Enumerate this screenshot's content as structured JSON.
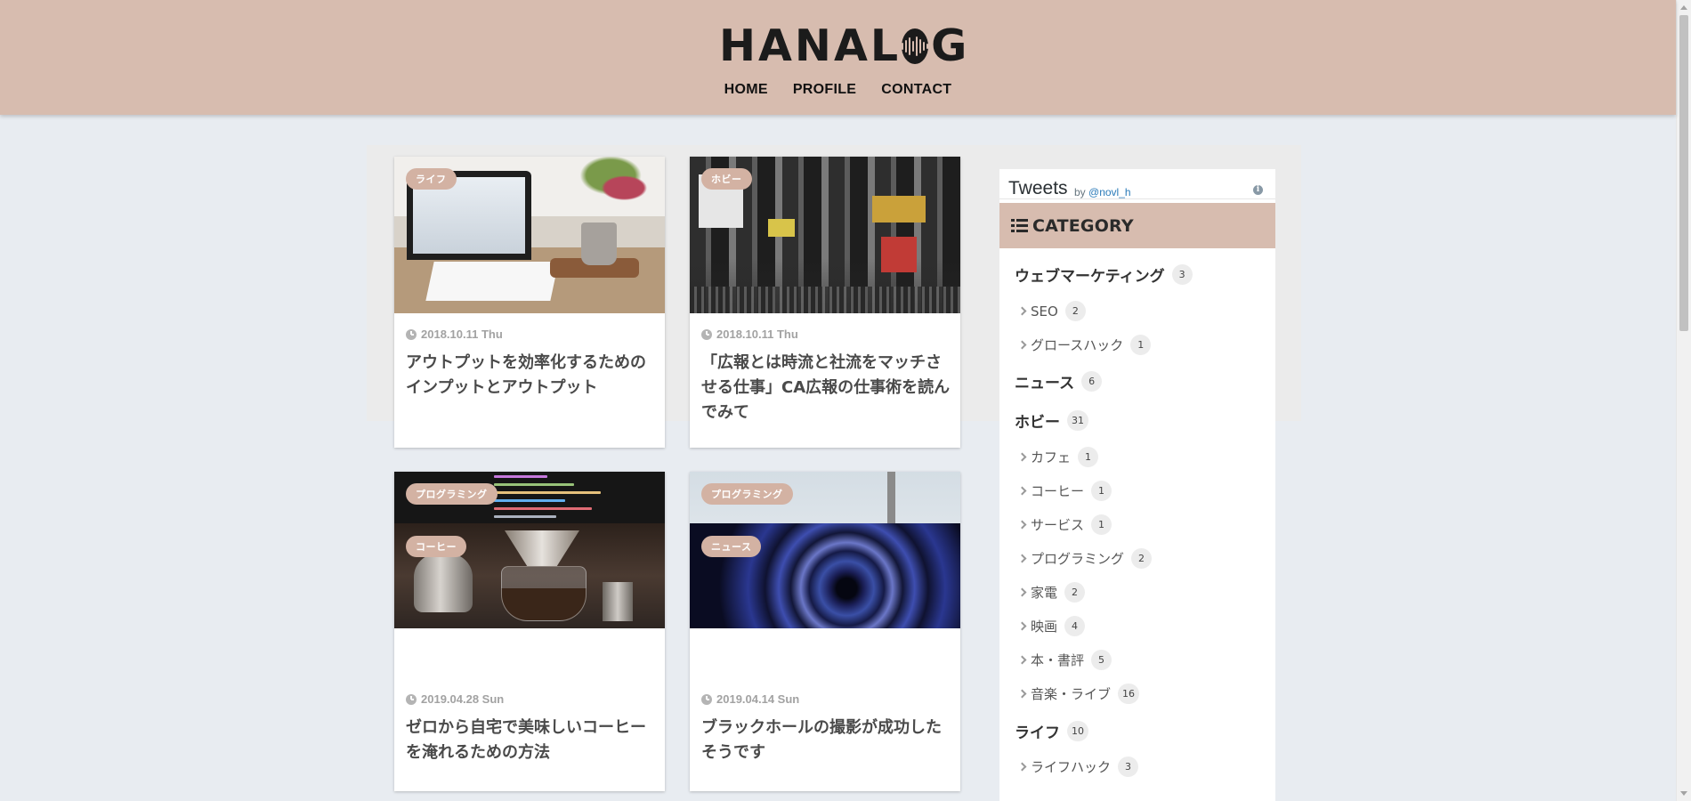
{
  "header": {
    "logo_pre": "HANAL",
    "logo_post": "G",
    "nav": [
      {
        "label": "HOME"
      },
      {
        "label": "PROFILE"
      },
      {
        "label": "CONTACT"
      }
    ]
  },
  "articles": [
    {
      "category": "ライフ",
      "date": "2018.10.11 Thu",
      "title": "アウトプットを効率化するためのインプットとアウトプット"
    },
    {
      "category": "ホビー",
      "date": "2018.10.11 Thu",
      "title": "「広報とは時流と社流をマッチさせる仕事」CA広報の仕事術を読んでみて"
    },
    {
      "category": "プログラミング",
      "category2": "コーヒー",
      "date": "2019.04.28 Sun",
      "title": "ゼロから自宅で美味しいコーヒーを淹れるための方法"
    },
    {
      "category": "プログラミング",
      "category2": "ニュース",
      "date": "2019.04.14 Sun",
      "title": "ブラックホールの撮影が成功したそうです"
    }
  ],
  "sidebar": {
    "tweets": {
      "title": "Tweets",
      "by": "by",
      "handle": "@novl_h",
      "info": "i"
    },
    "category_heading": "CATEGORY",
    "categories": [
      {
        "label": "ウェブマーケティング",
        "count": "3",
        "level": "parent"
      },
      {
        "label": "SEO",
        "count": "2",
        "level": "child"
      },
      {
        "label": "グロースハック",
        "count": "1",
        "level": "child"
      },
      {
        "label": "ニュース",
        "count": "6",
        "level": "parent"
      },
      {
        "label": "ホビー",
        "count": "31",
        "level": "parent"
      },
      {
        "label": "カフェ",
        "count": "1",
        "level": "child"
      },
      {
        "label": "コーヒー",
        "count": "1",
        "level": "child"
      },
      {
        "label": "サービス",
        "count": "1",
        "level": "child"
      },
      {
        "label": "プログラミング",
        "count": "2",
        "level": "child"
      },
      {
        "label": "家電",
        "count": "2",
        "level": "child"
      },
      {
        "label": "映画",
        "count": "4",
        "level": "child"
      },
      {
        "label": "本・書評",
        "count": "5",
        "level": "child"
      },
      {
        "label": "音楽・ライブ",
        "count": "16",
        "level": "child"
      },
      {
        "label": "ライフ",
        "count": "10",
        "level": "parent"
      },
      {
        "label": "ライフハック",
        "count": "3",
        "level": "child"
      }
    ]
  },
  "colors": {
    "header_bg": "#d7bcaf",
    "badge_bg": "#d3b2a3",
    "page_bg": "#e8ecf1",
    "link": "#2b7bb9"
  }
}
